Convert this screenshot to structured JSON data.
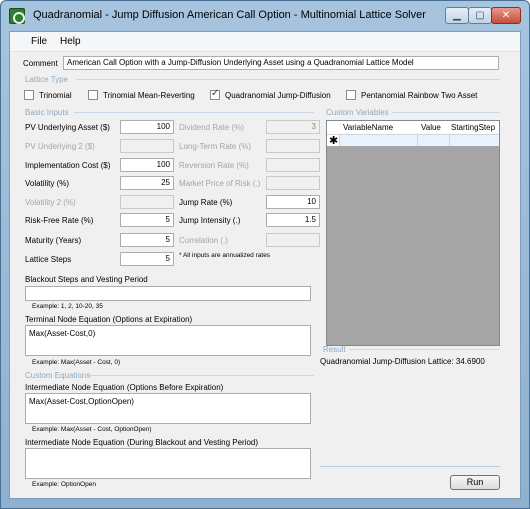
{
  "window": {
    "title": "Quadranomial - Jump Diffusion American Call Option - Multinomial Lattice Solver",
    "min_glyph": "▁",
    "max_glyph": "▢",
    "close_glyph": "✕"
  },
  "menu": {
    "file": "File",
    "help": "Help"
  },
  "comment": {
    "label": "Comment",
    "value": "American Call Option with a Jump-Diffusion Underlying Asset using a Quadranomial Lattice Model"
  },
  "lattice_type": {
    "section": "Lattice Type",
    "options": [
      {
        "label": "Trinomial",
        "checked": false
      },
      {
        "label": "Trinomial Mean-Reverting",
        "checked": false
      },
      {
        "label": "Quadranomial Jump-Diffusion",
        "checked": true
      },
      {
        "label": "Pentanomial Rainbow Two Asset",
        "checked": false
      }
    ]
  },
  "basic_inputs": {
    "section": "Basic Inputs",
    "pv_underlying": {
      "label": "PV Underlying Asset ($)",
      "value": "100"
    },
    "pv_underlying2": {
      "label": "PV Underlying 2 ($)",
      "value": ""
    },
    "implementation_cost": {
      "label": "Implementation Cost ($)",
      "value": "100"
    },
    "volatility": {
      "label": "Volatility (%)",
      "value": "25"
    },
    "volatility2": {
      "label": "Volatility 2 (%)",
      "value": ""
    },
    "risk_free": {
      "label": "Risk-Free Rate (%)",
      "value": "5"
    },
    "maturity": {
      "label": "Maturity (Years)",
      "value": "5"
    },
    "lattice_steps": {
      "label": "Lattice Steps",
      "value": "5"
    }
  },
  "right_inputs": {
    "dividend_rate": {
      "label": "Dividend Rate (%)",
      "value": "3"
    },
    "long_term_rate": {
      "label": "Long-Term Rate (%)",
      "value": ""
    },
    "reversion_rate": {
      "label": "Reversion Rate (%)",
      "value": ""
    },
    "market_price_risk": {
      "label": "Market Price of Risk (.)",
      "value": ""
    },
    "jump_rate": {
      "label": "Jump Rate (%)",
      "value": "10"
    },
    "jump_intensity": {
      "label": "Jump Intensity (.)",
      "value": "1.5"
    },
    "correlation": {
      "label": "Correlation (.)",
      "value": ""
    },
    "annualized_note": "* All inputs are annualized rates"
  },
  "blackout": {
    "label": "Blackout Steps and Vesting Period",
    "value": "",
    "example": "Example: 1, 2, 10-20, 35"
  },
  "terminal": {
    "label": "Terminal Node Equation (Options at Expiration)",
    "value": "Max(Asset-Cost,0)",
    "example": "Example: Max(Asset - Cost, 0)"
  },
  "custom_equations": {
    "section": "Custom Equations"
  },
  "intermediate": {
    "label": "Intermediate Node Equation (Options Before Expiration)",
    "value": "Max(Asset-Cost,OptionOpen)",
    "example": "Example: Max(Asset - Cost, OptionOpen)"
  },
  "intermediate_blackout": {
    "label": "Intermediate Node Equation (During Blackout and Vesting Period)",
    "value": "",
    "example": "Example: OptionOpen"
  },
  "custom_variables": {
    "section": "Custom Variables",
    "columns": [
      "VariableName",
      "Value",
      "StartingStep"
    ],
    "new_row_marker": "✱"
  },
  "result": {
    "section": "Result",
    "text": "Quadranomial Jump-Diffusion Lattice: 34.6900"
  },
  "run_button": "Run"
}
